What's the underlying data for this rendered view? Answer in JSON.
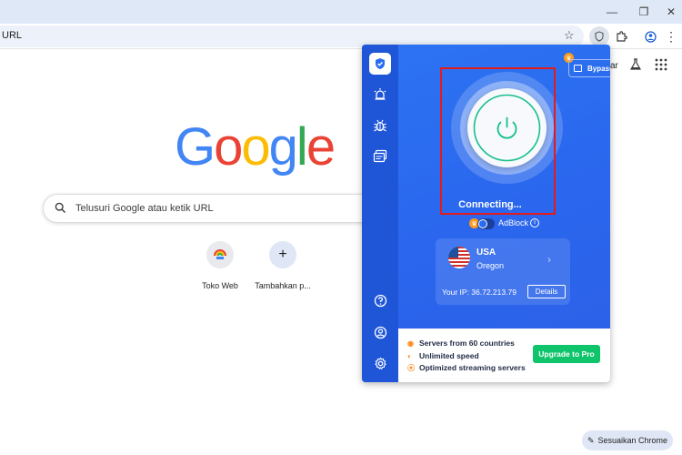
{
  "browser": {
    "omnibox": {
      "text": "URL"
    },
    "customize_label": "Sesuaikan Chrome",
    "ntp_partial_text": "ar"
  },
  "ntp": {
    "logo_letters": [
      "G",
      "o",
      "o",
      "g",
      "l",
      "e"
    ],
    "logo_colors": [
      "#4285F4",
      "#EA4335",
      "#FBBC05",
      "#4285F4",
      "#34A853",
      "#EA4335"
    ],
    "search_placeholder": "Telusuri Google atau ketik URL",
    "shortcuts": [
      {
        "label": "Toko Web",
        "icon": "chrome-web-store-icon"
      },
      {
        "label": "Tambahkan p...",
        "icon": "plus-icon"
      }
    ]
  },
  "vpn": {
    "bypass_label": "Bypass list",
    "status": "Connecting...",
    "adblock_label": "AdBlock",
    "location": {
      "country": "USA",
      "region": "Oregon"
    },
    "ip_text": "Your IP: 36.72.213.79",
    "details_label": "Details",
    "features": [
      "Servers from 60 countries",
      "Unlimited speed",
      "Optimized streaming servers"
    ],
    "upgrade_label": "Upgrade to Pro",
    "colors": {
      "primary": "#2A6CF0",
      "sidebar": "#1F56D8",
      "accent_green": "#10C46B",
      "crown": "#FF9B1A",
      "highlight": "#E41B1B"
    }
  }
}
